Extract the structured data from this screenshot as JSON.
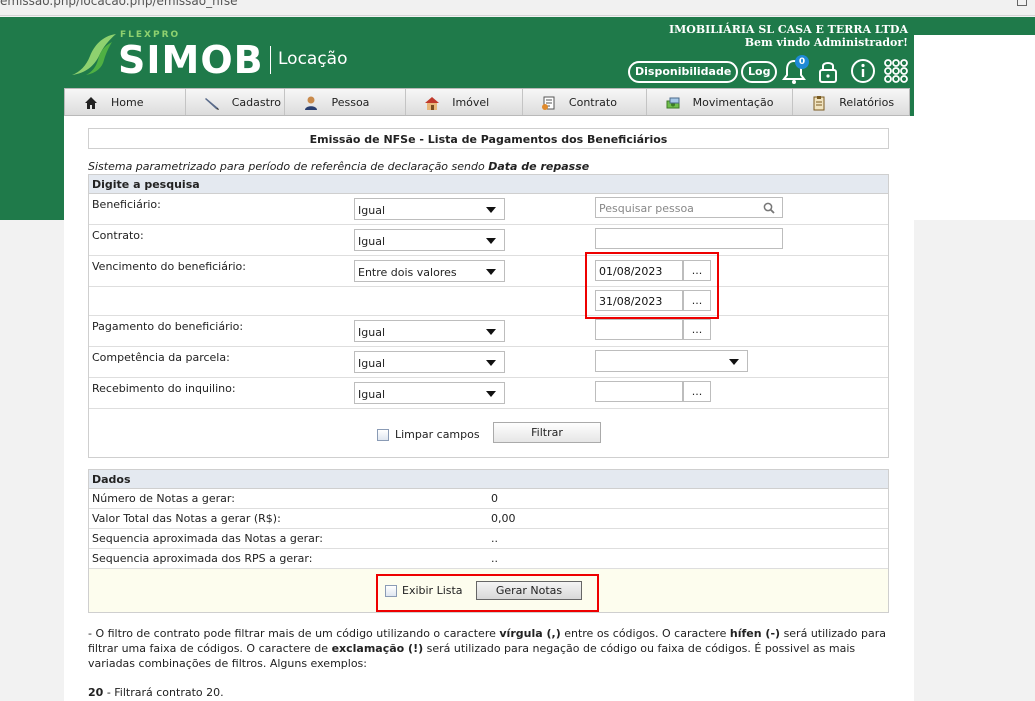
{
  "browser": {
    "url": "emissao.php/locacao.php/emissao_nfse"
  },
  "brand": {
    "flexpro": "FLEXPRO",
    "simob": "SIMOB",
    "module": "Locação"
  },
  "company": {
    "name": "IMOBILIÁRIA SL CASA E TERRA LTDA",
    "welcome": "Bem vindo Administrador!"
  },
  "topbar": {
    "disponibilidade": "Disponibilidade",
    "log": "Log",
    "notifications_count": "0"
  },
  "menu": [
    {
      "label": "Home",
      "icon": "home-icon"
    },
    {
      "label": "Cadastro",
      "icon": "pencil-icon"
    },
    {
      "label": "Pessoa",
      "icon": "person-icon"
    },
    {
      "label": "Imóvel",
      "icon": "house-icon"
    },
    {
      "label": "Contrato",
      "icon": "contract-icon"
    },
    {
      "label": "Movimentação",
      "icon": "money-icon"
    },
    {
      "label": "Relatórios",
      "icon": "clipboard-icon"
    }
  ],
  "page": {
    "title": "Emissão de NFSe - Lista de Pagamentos dos Beneficiários",
    "note_prefix": "Sistema parametrizado para período de referência de declaração sendo",
    "note_bold": "Data de repasse"
  },
  "search": {
    "heading": "Digite a pesquisa",
    "beneficiario": {
      "label": "Beneficiário:",
      "operator": "Igual",
      "placeholder": "Pesquisar pessoa"
    },
    "contrato": {
      "label": "Contrato:",
      "operator": "Igual",
      "value": ""
    },
    "vencimento": {
      "label": "Vencimento do beneficiário:",
      "operator": "Entre dois valores",
      "from": "01/08/2023",
      "to": "31/08/2023"
    },
    "pagamento": {
      "label": "Pagamento do beneficiário:",
      "operator": "Igual",
      "value": ""
    },
    "competencia": {
      "label": "Competência da parcela:",
      "operator": "Igual",
      "value": ""
    },
    "recebimento": {
      "label": "Recebimento do inquilino:",
      "operator": "Igual",
      "value": ""
    },
    "dots": "...",
    "clear_label": "Limpar campos",
    "filter_label": "Filtrar"
  },
  "dados": {
    "heading": "Dados",
    "rows": [
      {
        "label": "Número de Notas a gerar:",
        "value": "0"
      },
      {
        "label": "Valor Total das Notas a gerar (R$):",
        "value": "0,00"
      },
      {
        "label": "Sequencia aproximada das Notas a gerar:",
        "value": ".."
      },
      {
        "label": "Sequencia aproximada dos RPS a gerar:",
        "value": ".."
      }
    ],
    "show_list_label": "Exibir Lista",
    "generate_label": "Gerar Notas"
  },
  "help": {
    "p1": "- O filtro de contrato pode filtrar mais de um código utilizando o caractere",
    "virgula": "vírgula (,)",
    "p2": "entre os códigos. O caractere",
    "hifen": "hífen (-)",
    "p3": "será utilizado para filtrar uma faixa de códigos. O caractere de",
    "exclamacao": "exclamação (!)",
    "p4": "será utilizado para negação de código ou faixa de códigos. É possivel as mais variadas combinações de filtros. Alguns exemplos:",
    "example_code": "20",
    "example_text": "- Filtrará contrato 20."
  },
  "colors": {
    "header_green": "#1f7a4a",
    "highlight_red": "#ee0000",
    "section_header": "#e4e9f0"
  }
}
